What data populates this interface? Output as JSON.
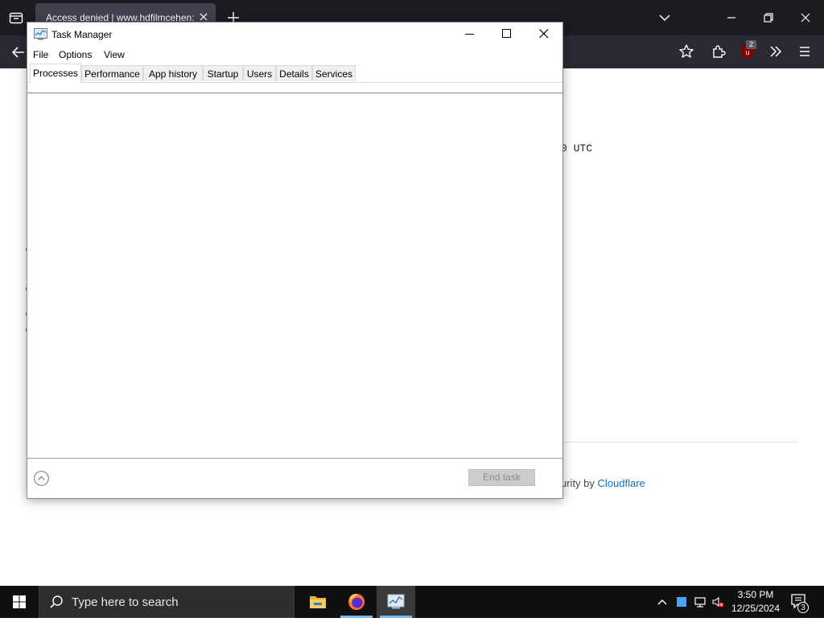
{
  "browser": {
    "tab_title": "Access denied | www.hdfilmcehen:",
    "ublock_badge": "2"
  },
  "page": {
    "utc_fragment": "0 UTC",
    "footer_prefix": "urity by",
    "footer_link": "Cloudflare"
  },
  "task_manager": {
    "title": "Task Manager",
    "menu": [
      "File",
      "Options",
      "View"
    ],
    "tabs": [
      "Processes",
      "Performance",
      "App history",
      "Startup",
      "Users",
      "Details",
      "Services"
    ],
    "active_tab": "Processes",
    "end_task_label": "End task"
  },
  "taskbar": {
    "search_placeholder": "Type here to search",
    "time": "3:50 PM",
    "date": "12/25/2024",
    "notification_count": "3",
    "apps": [
      "file-explorer-icon",
      "firefox-icon",
      "task-manager-icon"
    ]
  },
  "colors": {
    "browser_titlebar": "#1c1b22",
    "browser_toolbar": "#2b2a33",
    "taskbar": "#101010",
    "link": "#0b6fc2"
  }
}
